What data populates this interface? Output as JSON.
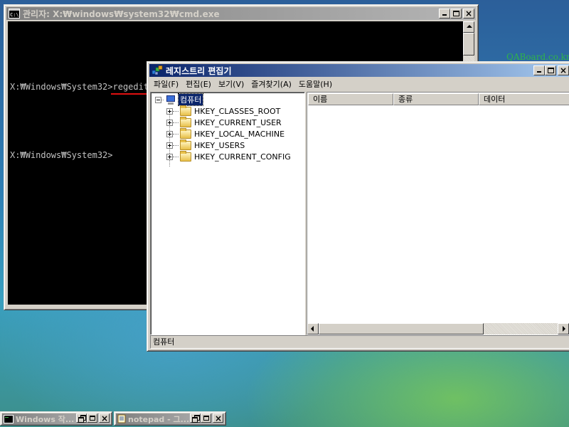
{
  "watermark": "QABoard.co.kr",
  "cmd_window": {
    "title": "관리자: X:₩windows₩system32₩cmd.exe",
    "lines": [
      {
        "prompt": "X:₩Windows₩System32>",
        "typed": "regedit"
      },
      {
        "prompt": "X:₩Windows₩System32>",
        "typed": ""
      }
    ]
  },
  "regedit_window": {
    "title": "레지스트리 편집기",
    "menu": [
      "파일(F)",
      "편집(E)",
      "보기(V)",
      "즐겨찾기(A)",
      "도움말(H)"
    ],
    "tree": {
      "root": "컴퓨터",
      "keys": [
        "HKEY_CLASSES_ROOT",
        "HKEY_CURRENT_USER",
        "HKEY_LOCAL_MACHINE",
        "HKEY_USERS",
        "HKEY_CURRENT_CONFIG"
      ]
    },
    "columns": [
      "이름",
      "종류",
      "데이터"
    ],
    "status": "컴퓨터"
  },
  "minimized_windows": [
    {
      "title": "Windows 작...",
      "icon": "console-icon"
    },
    {
      "title": "notepad - 그...",
      "icon": "notepad-icon"
    }
  ]
}
